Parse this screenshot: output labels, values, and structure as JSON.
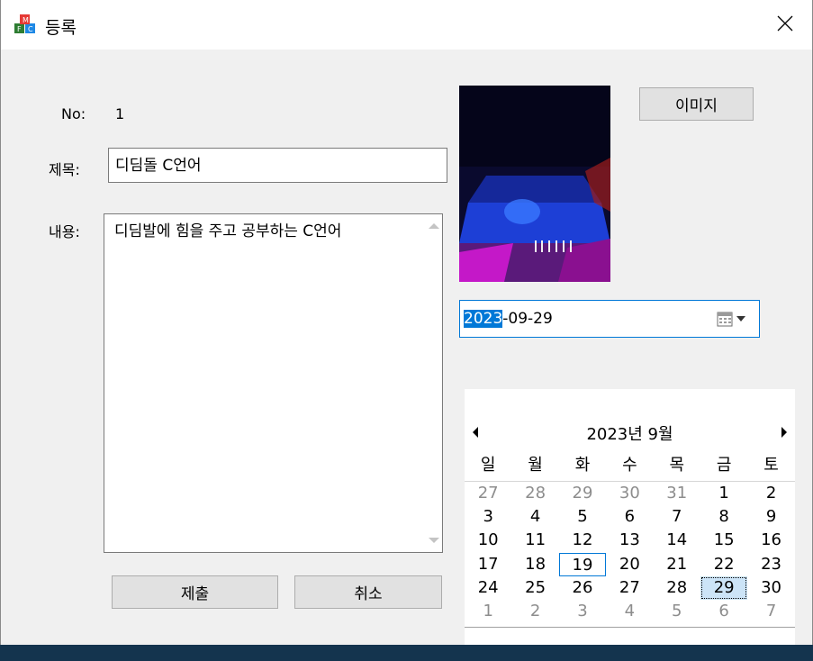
{
  "window": {
    "title": "등록"
  },
  "form": {
    "no_label": "No:",
    "no_value": "1",
    "title_label": "제목:",
    "title_value": "디딤돌 C언어",
    "content_label": "내용:",
    "content_value": "디딤발에 힘을 주고 공부하는 C언어",
    "submit_label": "제출",
    "cancel_label": "취소",
    "image_button_label": "이미지"
  },
  "date_picker": {
    "selected_part": "2023",
    "rest": "-09-29"
  },
  "calendar": {
    "title": "2023년 9월",
    "weekdays": [
      "일",
      "월",
      "화",
      "수",
      "목",
      "금",
      "토"
    ],
    "weeks": [
      [
        "27",
        "28",
        "29",
        "30",
        "31",
        "1",
        "2"
      ],
      [
        "3",
        "4",
        "5",
        "6",
        "7",
        "8",
        "9"
      ],
      [
        "10",
        "11",
        "12",
        "13",
        "14",
        "15",
        "16"
      ],
      [
        "17",
        "18",
        "19",
        "20",
        "21",
        "22",
        "23"
      ],
      [
        "24",
        "25",
        "26",
        "27",
        "28",
        "29",
        "30"
      ],
      [
        "1",
        "2",
        "3",
        "4",
        "5",
        "6",
        "7"
      ]
    ],
    "today": "19",
    "selected": "29"
  },
  "colors": {
    "accent": "#0078d7",
    "dim_text": "#8d8d8d",
    "selected_bg": "#cce4f7"
  }
}
